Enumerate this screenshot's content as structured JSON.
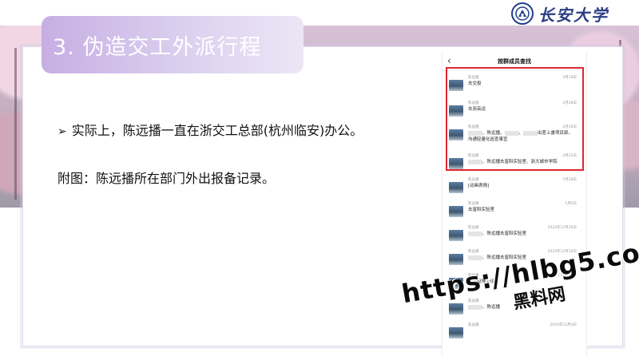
{
  "slide": {
    "title": "3. 伪造交工外派行程",
    "bullet": "实际上，陈远播一直在浙交工总部(杭州临安)办公。",
    "caption": "附图：陈远播所在部门外出报备记录。"
  },
  "logo": {
    "text": "长安大学",
    "emblem_color": "#1f3d8a"
  },
  "phone": {
    "title": "按群成员查找",
    "messages": [
      {
        "sender": "陈远播",
        "date": "3月19日",
        "text": "去交投",
        "blurred": false
      },
      {
        "sender": "陈远播",
        "date": "2月28日",
        "text": "去浙高运",
        "blurred": false
      },
      {
        "sender": "陈远播",
        "date": "2月26日",
        "text_parts": [
          "、陈远播、",
          "、",
          "出差上虞项目部，沟通轻量化巡查事宜"
        ],
        "blurred": true
      },
      {
        "sender": "陈远播",
        "date": "2月25日",
        "text_parts": [
          "、陈远播去富阳实验室、浙大城市学院"
        ],
        "blurred": true
      },
      {
        "sender": "陈远播",
        "date": "1月28日",
        "text": "[动画表情]",
        "blurred": false
      },
      {
        "sender": "陈远播",
        "date": "1月6日",
        "text": "去富阳实验室",
        "blurred": false
      },
      {
        "sender": "陈远播",
        "date": "2024年12月26日",
        "text_parts": [
          "、陈远播去富阳实验室"
        ],
        "blurred": true
      },
      {
        "sender": "陈远播",
        "date": "2024年12月18日",
        "text_parts": [
          "、陈远播去富阳实验室"
        ],
        "blurred": true
      },
      {
        "sender": "陈远播",
        "date": "2024年12月13日",
        "text": "去交投博士论坛",
        "blurred": false
      },
      {
        "sender": "陈远播",
        "date": "",
        "text_parts": [
          "、陈远播"
        ],
        "blurred": true
      },
      {
        "sender": "陈远播",
        "date": "2024年12月4日",
        "text": "",
        "blurred": false
      }
    ]
  },
  "watermark": {
    "url": "https://hlbg5.com",
    "text": "黑料网"
  },
  "colors": {
    "title_gradient_start": "#c6aee3",
    "highlight_box": "#e0262d"
  }
}
